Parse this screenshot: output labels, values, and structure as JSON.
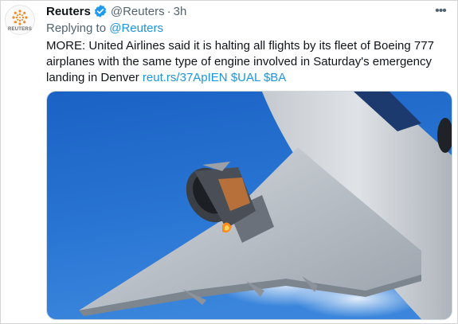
{
  "tweet": {
    "author_name": "Reuters",
    "avatar_wordmark": "REUTERS",
    "handle": "@Reuters",
    "separator": "·",
    "time": "3h",
    "more_glyph": "•••",
    "reply_prefix": "Replying to",
    "reply_to": "@Reuters",
    "text": "MORE: United Airlines said it is halting all flights by its fleet of Boeing 777 airplanes with the same type of engine involved in Saturday's emergency landing in Denver",
    "links": [
      "reut.rs/37ApIEN",
      "$UAL",
      "$BA"
    ]
  },
  "icons": {
    "verified": "verified-badge-icon",
    "more": "more-icon",
    "logo": "reuters-logo-icon"
  },
  "colors": {
    "link": "#1b95e0",
    "secondary_text": "#536471",
    "verified": "#1d9bf0",
    "logo_orange": "#f08a24"
  },
  "media": {
    "subject": "damaged-engine-photo"
  }
}
